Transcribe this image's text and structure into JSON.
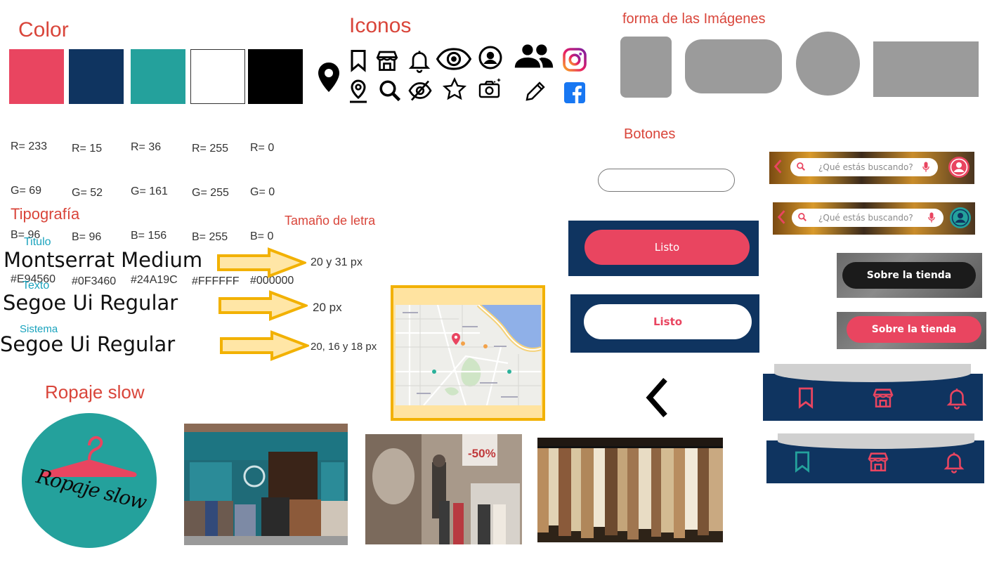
{
  "headings": {
    "color": "Color",
    "iconos": "Iconos",
    "forma": "forma de las Imágenes",
    "botones": "Botones",
    "tipografia": "Tipografía",
    "tamano": "Tamaño de letra",
    "ropaje": "Ropaje slow"
  },
  "colors": [
    {
      "hex_color": "#E94560",
      "r": "R= 233",
      "g": "G= 69",
      "b": "B= 96",
      "hex": "#E94560"
    },
    {
      "hex_color": "#0F3460",
      "r": "R= 15",
      "g": "G= 52",
      "b": "B= 96",
      "hex": "#0F3460"
    },
    {
      "hex_color": "#24A19C",
      "r": "R= 36",
      "g": "G= 161",
      "b": "B= 156",
      "hex": "#24A19C"
    },
    {
      "hex_color": "#FFFFFF",
      "r": "R= 255",
      "g": "G= 255",
      "b": "B= 255",
      "hex": "#FFFFFF"
    },
    {
      "hex_color": "#000000",
      "r": "R= 0",
      "g": "G= 0",
      "b": "B= 0",
      "hex": "#000000"
    }
  ],
  "icons": [
    "location-pin-icon",
    "bookmark-icon",
    "store-icon",
    "bell-icon",
    "eye-icon",
    "user-circle-icon",
    "group-icon",
    "instagram-icon",
    "location-marker-icon",
    "search-icon",
    "eye-off-icon",
    "star-icon",
    "camera-sparkle-icon",
    "pencil-icon",
    "facebook-icon"
  ],
  "typography": {
    "titulo_label": "Titulo",
    "titulo_font": "Montserrat Medium",
    "titulo_size": "20 y 31 px",
    "texto_label": "Texto",
    "texto_font": "Segoe Ui Regular",
    "texto_size": "20 px",
    "sistema_label": "Sistema",
    "sistema_font": "Segoe Ui Regular",
    "sistema_size": "20, 16 y 18 px"
  },
  "buttons": {
    "listo_1": "Listo",
    "listo_2": "Listo",
    "search_placeholder_1": "¿Qué estás buscando?",
    "search_placeholder_2": "¿Qué estás buscando?",
    "sobre_1": "Sobre la tienda",
    "sobre_2": "Sobre la tienda"
  },
  "brand": {
    "logo_text": "Ropaje slow"
  },
  "photos": {
    "sale_tag": "-50%"
  },
  "accent": "#E94560",
  "navy": "#0F3460",
  "teal": "#24A19C"
}
